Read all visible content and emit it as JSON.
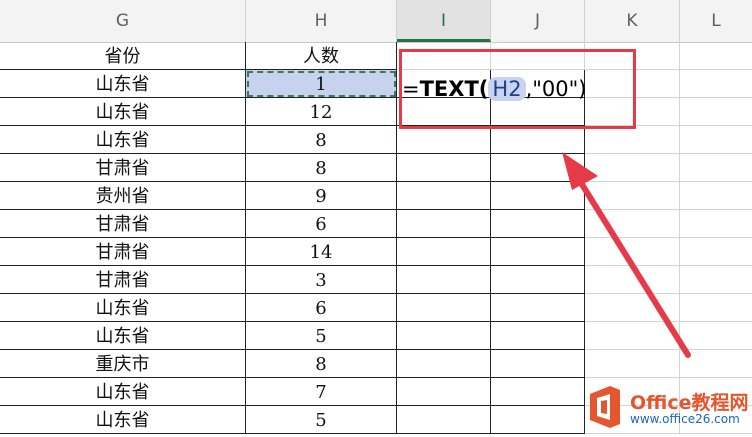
{
  "columns": [
    "G",
    "H",
    "I",
    "J",
    "K",
    "L"
  ],
  "active_column": "I",
  "headers": {
    "province": "省份",
    "count": "人数"
  },
  "rows": [
    {
      "province": "山东省",
      "count": "1"
    },
    {
      "province": "山东省",
      "count": "12"
    },
    {
      "province": "山东省",
      "count": "8"
    },
    {
      "province": "甘肃省",
      "count": "8"
    },
    {
      "province": "贵州省",
      "count": "9"
    },
    {
      "province": "甘肃省",
      "count": "6"
    },
    {
      "province": "甘肃省",
      "count": "14"
    },
    {
      "province": "甘肃省",
      "count": "3"
    },
    {
      "province": "山东省",
      "count": "6"
    },
    {
      "province": "山东省",
      "count": "5"
    },
    {
      "province": "重庆市",
      "count": "8"
    },
    {
      "province": "山东省",
      "count": "7"
    },
    {
      "province": "山东省",
      "count": "5"
    }
  ],
  "formula": {
    "prefix": "=",
    "function": "TEXT(",
    "ref": "H2",
    "rest": ",\"00\")"
  },
  "logo": {
    "text": "Office教程网",
    "url": "www.office26.com"
  },
  "colors": {
    "highlight_box": "#e53a48",
    "arrow": "#e53a48",
    "selection": "#c6d2ee",
    "logo_orange": "#e4572e"
  }
}
